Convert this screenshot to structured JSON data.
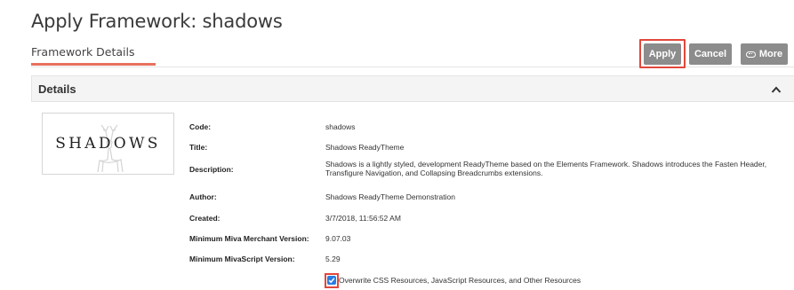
{
  "page": {
    "title": "Apply Framework: shadows"
  },
  "tabs": [
    {
      "label": "Framework Details",
      "active": true
    }
  ],
  "toolbar": {
    "apply_label": "Apply",
    "cancel_label": "Cancel",
    "more_label": "More"
  },
  "panel": {
    "title": "Details",
    "toggle_icon": "chevron-up-icon"
  },
  "logo": {
    "text": "SHADOWS",
    "icon": "deer-icon"
  },
  "details": {
    "code": {
      "label": "Code:",
      "value": "shadows"
    },
    "title": {
      "label": "Title:",
      "value": "Shadows ReadyTheme"
    },
    "description": {
      "label": "Description:",
      "value": "Shadows is a lightly styled, development ReadyTheme based on the Elements Framework. Shadows introduces the Fasten Header, Transfigure Navigation, and Collapsing Breadcrumbs extensions."
    },
    "author": {
      "label": "Author:",
      "value": "Shadows ReadyTheme Demonstration"
    },
    "created": {
      "label": "Created:",
      "value": "3/7/2018, 11:56:52 AM"
    },
    "min_merchant": {
      "label": "Minimum Miva Merchant Version:",
      "value": "9.07.03"
    },
    "min_mivascript": {
      "label": "Minimum MivaScript Version:",
      "value": "5.29"
    }
  },
  "overwrite": {
    "checked": true,
    "label": "Overwrite CSS Resources, JavaScript Resources, and Other Resources"
  },
  "colors": {
    "accent_underline": "#e8705f",
    "button_gray": "#8c8c8c",
    "highlight_red": "#e2473b",
    "checkbox_blue": "#2a7de1"
  }
}
